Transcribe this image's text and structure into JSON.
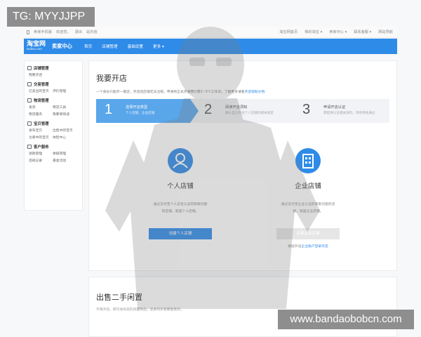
{
  "watermark_top": "TG: MYYJJPP",
  "watermark_bottom": "www.bandaobobcn.com",
  "topbar": {
    "left": [
      "卖家手机版",
      "欢迎您，",
      "退出",
      "站内信"
    ],
    "right": [
      "淘宝网首页",
      "我的淘宝 ▾",
      "卖家中心 ▾",
      "联系客服 ▾",
      "网站导航"
    ]
  },
  "navbar": {
    "logo_cn": "淘宝网",
    "logo_en": "taobao.com",
    "title": "卖家中心",
    "items": [
      "首页",
      "店铺管理",
      "基础设置",
      "更多"
    ]
  },
  "sidebar": [
    {
      "title": "店铺管理",
      "icon": "store-icon",
      "links": [
        "我要开店"
      ]
    },
    {
      "title": "交易管理",
      "icon": "trade-icon",
      "links": [
        "已卖出的宝贝",
        "评价管理"
      ]
    },
    {
      "title": "物流管理",
      "icon": "logistics-icon",
      "links": [
        "发货",
        "物流工具",
        "物流服务",
        "我要寄快递"
      ]
    },
    {
      "title": "宝贝管理",
      "icon": "goods-icon",
      "links": [
        "发布宝贝",
        "出售中的宝贝",
        "仓库中的宝贝",
        "体检中心"
      ]
    },
    {
      "title": "客户服务",
      "icon": "service-icon",
      "links": [
        "退款管理",
        "举报管理",
        "违规记录",
        "基金活动"
      ]
    }
  ],
  "main": {
    "title": "我要开店",
    "intro": "一个身份只能开一家店，开店后店铺无法注销，申请到正式开通预计需1~3个工作日。了解更多请看",
    "intro_link": "开店帮助文档",
    "steps": [
      {
        "num": "1",
        "title": "选择开店类型",
        "desc": "个人店铺，企业店铺"
      },
      {
        "num": "2",
        "title": "阅读开店须知",
        "desc": "确认自己符合个人店铺的相关规定"
      },
      {
        "num": "3",
        "title": "申请开店认证",
        "desc": "需提供认证相关资料，等待审核通过"
      }
    ],
    "options": [
      {
        "name": "个人店铺",
        "icon": "person-icon",
        "desc1": "通过支付宝个人实名认证的商家创建",
        "desc2": "的店铺，就是个人店铺。",
        "button": "创建个人店铺"
      },
      {
        "name": "企业店铺",
        "icon": "building-icon",
        "desc1": "通过支付宝企业认证的商家创建的店",
        "desc2": "铺，就是企业店铺。",
        "button": "创建企业店铺",
        "sub": "继续开设",
        "sub_link": "企业账户登录开店"
      }
    ]
  },
  "second": {
    "title": "出售二手闲置",
    "desc": "不用开店，即可发布您的闲置物品，卖家和买家都能看到。"
  },
  "colors": {
    "brand": "#2f8be8",
    "watermark": "#8e8e8e"
  }
}
